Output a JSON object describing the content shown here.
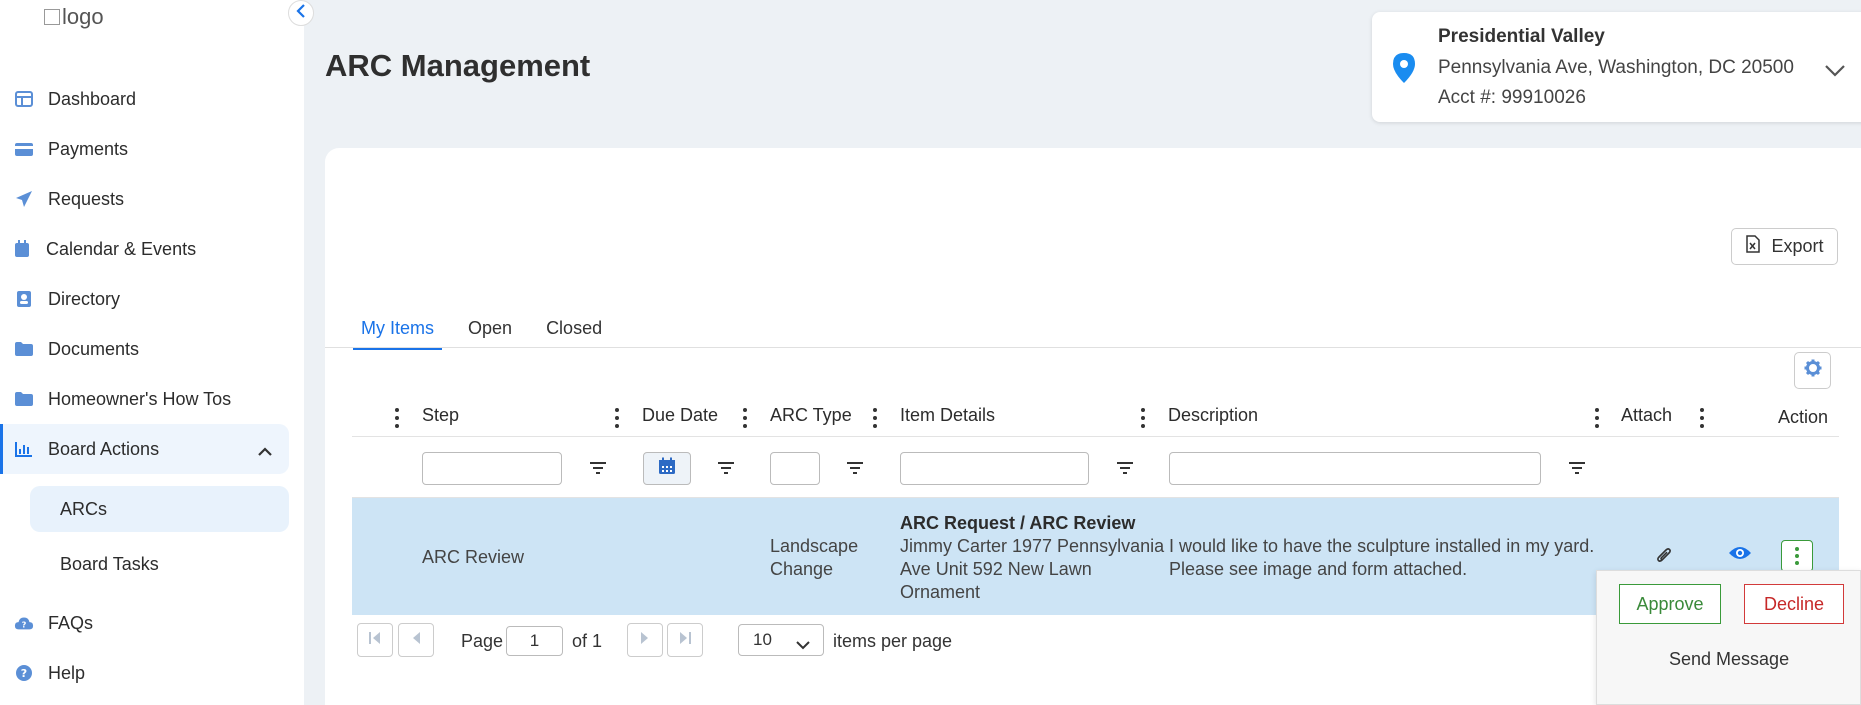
{
  "app": {
    "logo_alt": "logo"
  },
  "sidebar": {
    "items": [
      {
        "label": "Dashboard",
        "icon": "dashboard-icon"
      },
      {
        "label": "Payments",
        "icon": "credit-card-icon"
      },
      {
        "label": "Requests",
        "icon": "paper-plane-icon"
      },
      {
        "label": "Calendar & Events",
        "icon": "calendar-icon"
      },
      {
        "label": "Directory",
        "icon": "contact-card-icon"
      },
      {
        "label": "Documents",
        "icon": "folder-icon"
      },
      {
        "label": "Homeowner's How Tos",
        "icon": "folder-icon"
      },
      {
        "label": "Board Actions",
        "icon": "bar-chart-icon",
        "expanded": true,
        "active": true
      },
      {
        "label": "FAQs",
        "icon": "cloud-question-icon"
      },
      {
        "label": "Help",
        "icon": "question-circle-icon"
      }
    ],
    "subitems": [
      {
        "label": "ARCs",
        "active": true
      },
      {
        "label": "Board Tasks",
        "active": false
      }
    ]
  },
  "header": {
    "title": "ARC Management"
  },
  "location": {
    "name": "Presidential Valley",
    "address": "Pennsylvania Ave, Washington, DC 20500",
    "account": "Acct #: 99910026"
  },
  "toolbar": {
    "export_label": "Export"
  },
  "tabs": [
    {
      "label": "My Items",
      "active": true
    },
    {
      "label": "Open",
      "active": false
    },
    {
      "label": "Closed",
      "active": false
    }
  ],
  "table": {
    "columns": [
      "Step",
      "Due Date",
      "ARC Type",
      "Item Details",
      "Description",
      "Attach",
      "Action"
    ],
    "rows": [
      {
        "step": "ARC Review",
        "due_date": "",
        "arc_type_line1": "Landscape",
        "arc_type_line2": "Change",
        "item_title": "ARC Request / ARC Review",
        "item_line1": "Jimmy Carter 1977 Pennsylvania",
        "item_line2": "Ave Unit 592 New Lawn",
        "item_line3": "Ornament",
        "description_line1": "I would like to have the sculpture installed in my yard.",
        "description_line2": "Please see image and form attached."
      }
    ]
  },
  "pager": {
    "page_label": "Page",
    "page_value": "1",
    "of_label": "of 1",
    "per_page_value": "10",
    "per_page_label": "items per page"
  },
  "action_menu": {
    "approve": "Approve",
    "decline": "Decline",
    "send_message": "Send Message"
  },
  "colors": {
    "accent": "#1a73e8",
    "row_highlight": "#cde4f5",
    "approve": "#3a9a3a",
    "decline": "#d23a3a"
  }
}
